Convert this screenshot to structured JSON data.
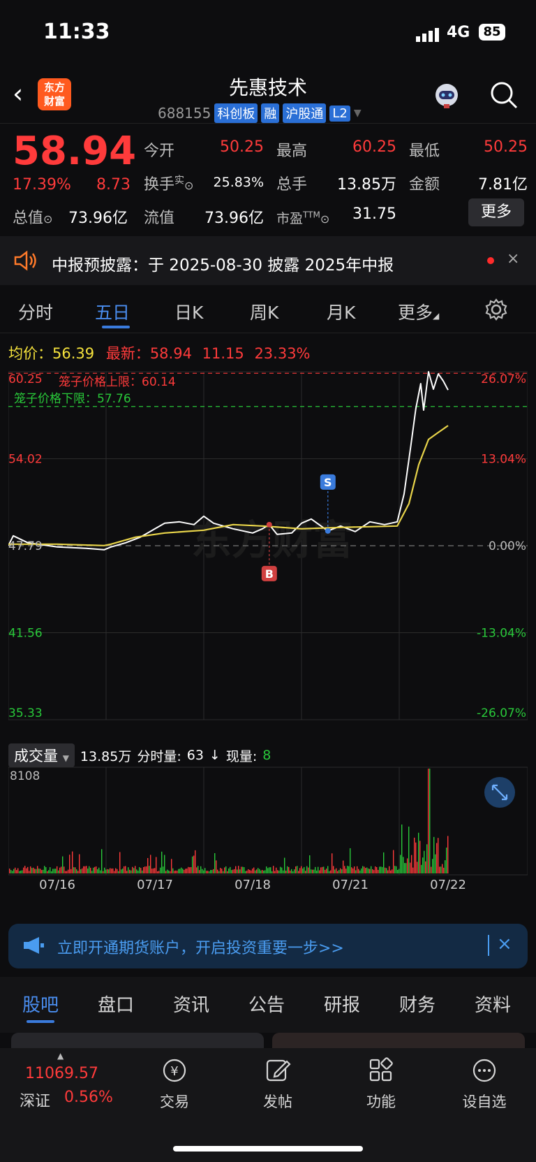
{
  "status": {
    "time": "11:33",
    "network": "4G",
    "battery": "85"
  },
  "header": {
    "title": "先惠技术",
    "code": "688155",
    "tags": [
      "科创板",
      "融",
      "沪股通",
      "L2"
    ],
    "logo_text": "东方财富"
  },
  "quote": {
    "price": "58.94",
    "change_pct": "17.39%",
    "change": "8.73",
    "open_label": "今开",
    "open": "50.25",
    "high_label": "最高",
    "high": "60.25",
    "low_label": "最低",
    "low": "50.25",
    "turnover_label": "换手",
    "turnover_sup": "实",
    "turnover": "25.83%",
    "volume_label": "总手",
    "volume": "13.85万",
    "amount_label": "金额",
    "amount": "7.81亿",
    "mktcap_label": "总值",
    "mktcap": "73.96亿",
    "float_label": "流值",
    "float": "73.96亿",
    "pe_label": "市盈",
    "pe_sup": "TTM",
    "pe": "31.75",
    "more": "更多"
  },
  "notice": {
    "text": "中报预披露：于 2025-08-30 披露 2025年中报",
    "close": "×"
  },
  "tabs": [
    "分时",
    "五日",
    "日K",
    "周K",
    "月K",
    "更多"
  ],
  "legend": {
    "avg_label": "均价：",
    "avg": "56.39",
    "last_label": "最新：",
    "last": "58.94",
    "chg": "11.15",
    "pct": "23.33%"
  },
  "chart_data": {
    "type": "line",
    "title": "",
    "x_labels": [
      "07/16",
      "07/17",
      "07/18",
      "07/21",
      "07/22"
    ],
    "y_ticks": [
      "60.25",
      "54.02",
      "47.79",
      "41.56",
      "35.33"
    ],
    "pct_ticks": [
      "26.07%",
      "13.04%",
      "0.00%",
      "-13.04%",
      "-26.07%"
    ],
    "ylim": [
      35.33,
      60.25
    ],
    "cage_upper_label": "笼子价格上限：60.14",
    "cage_lower_label": "笼子价格下限：57.76",
    "cage_upper": 60.14,
    "cage_lower": 57.76,
    "markers": [
      {
        "label": "S",
        "day": 3.27,
        "price": 48.85
      },
      {
        "label": "B",
        "day": 2.67,
        "price": 49.3
      }
    ],
    "watermark": "东方财富",
    "series": [
      {
        "name": "price",
        "color": "#ffffff",
        "points": [
          [
            0,
            47.8
          ],
          [
            0.05,
            48.5
          ],
          [
            0.2,
            48.0
          ],
          [
            0.5,
            47.7
          ],
          [
            0.8,
            47.6
          ],
          [
            0.98,
            47.5
          ],
          [
            1.05,
            47.7
          ],
          [
            1.2,
            48.0
          ],
          [
            1.35,
            48.4
          ],
          [
            1.5,
            49.0
          ],
          [
            1.6,
            49.4
          ],
          [
            1.75,
            49.5
          ],
          [
            1.9,
            49.3
          ],
          [
            2.0,
            49.9
          ],
          [
            2.1,
            49.4
          ],
          [
            2.3,
            49.0
          ],
          [
            2.5,
            48.7
          ],
          [
            2.6,
            49.0
          ],
          [
            2.67,
            49.3
          ],
          [
            2.75,
            48.6
          ],
          [
            2.9,
            48.7
          ],
          [
            3.0,
            49.4
          ],
          [
            3.1,
            49.7
          ],
          [
            3.27,
            48.85
          ],
          [
            3.4,
            49.2
          ],
          [
            3.55,
            48.8
          ],
          [
            3.7,
            49.5
          ],
          [
            3.85,
            49.3
          ],
          [
            3.98,
            49.5
          ],
          [
            4.05,
            51.5
          ],
          [
            4.12,
            55.0
          ],
          [
            4.17,
            57.6
          ],
          [
            4.22,
            59.4
          ],
          [
            4.25,
            57.5
          ],
          [
            4.3,
            60.25
          ],
          [
            4.35,
            59.0
          ],
          [
            4.4,
            60.1
          ],
          [
            4.45,
            59.6
          ],
          [
            4.5,
            58.94
          ]
        ]
      },
      {
        "name": "avg",
        "color": "#e8d44a",
        "points": [
          [
            0,
            47.9
          ],
          [
            0.5,
            47.9
          ],
          [
            0.98,
            47.8
          ],
          [
            1.05,
            47.9
          ],
          [
            1.3,
            48.4
          ],
          [
            1.6,
            48.7
          ],
          [
            2.0,
            48.9
          ],
          [
            2.3,
            49.3
          ],
          [
            2.6,
            49.2
          ],
          [
            3.0,
            49.0
          ],
          [
            3.4,
            49.1
          ],
          [
            3.98,
            49.2
          ],
          [
            4.1,
            50.8
          ],
          [
            4.2,
            53.6
          ],
          [
            4.3,
            55.4
          ],
          [
            4.4,
            55.9
          ],
          [
            4.5,
            56.39
          ]
        ]
      }
    ],
    "volume": {
      "label": "成交量",
      "total": "13.85万",
      "minute_label": "分时量:",
      "minute": "63",
      "current_label": "现量:",
      "current": "8",
      "max_tick": "8108"
    }
  },
  "ad": {
    "text": "立即开通期货账户，开启投资重要一步>>",
    "close": "×"
  },
  "bottom_tabs": [
    "股吧",
    "盘口",
    "资讯",
    "公告",
    "研报",
    "财务",
    "资料"
  ],
  "index": {
    "value": "11069.57",
    "name": "深证",
    "pct": "0.56%"
  },
  "bottom_nav": [
    {
      "label": "交易",
      "icon": "yuan-icon"
    },
    {
      "label": "发帖",
      "icon": "edit-icon"
    },
    {
      "label": "功能",
      "icon": "grid-icon"
    },
    {
      "label": "设自选",
      "icon": "more-icon"
    }
  ]
}
